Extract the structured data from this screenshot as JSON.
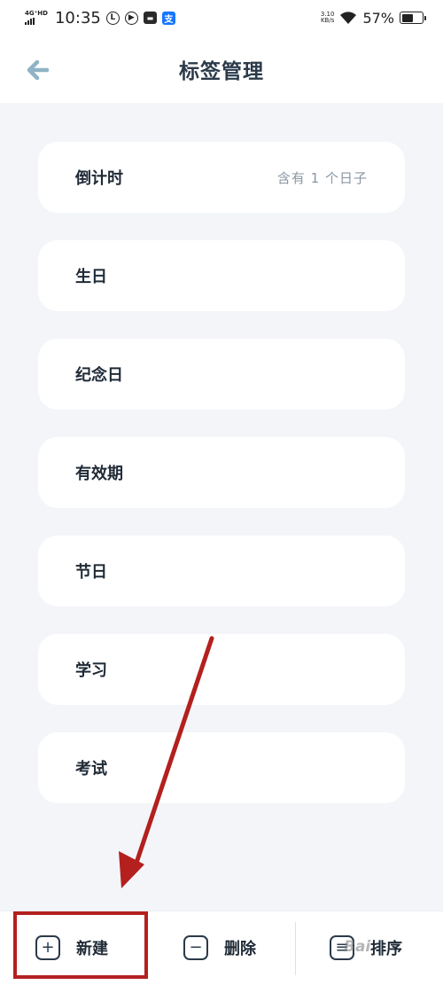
{
  "status_bar": {
    "network_type": "4G⁺HD",
    "time": "10:35",
    "speed_value": "3.10",
    "speed_unit": "KB/s",
    "battery_percent": "57%",
    "battery_level": 0.57
  },
  "header": {
    "title": "标签管理"
  },
  "tags": [
    {
      "name": "倒计时",
      "count_text": "含有 1 个日子"
    },
    {
      "name": "生日",
      "count_text": ""
    },
    {
      "name": "纪念日",
      "count_text": ""
    },
    {
      "name": "有效期",
      "count_text": ""
    },
    {
      "name": "节日",
      "count_text": ""
    },
    {
      "name": "学习",
      "count_text": ""
    },
    {
      "name": "考试",
      "count_text": ""
    }
  ],
  "toolbar": {
    "new_label": "新建",
    "delete_label": "删除",
    "sort_label": "排序"
  },
  "watermark": "Bai",
  "colors": {
    "accent": "#8fb3c4",
    "annotation": "#b3201e",
    "background": "#f3f5f9"
  }
}
